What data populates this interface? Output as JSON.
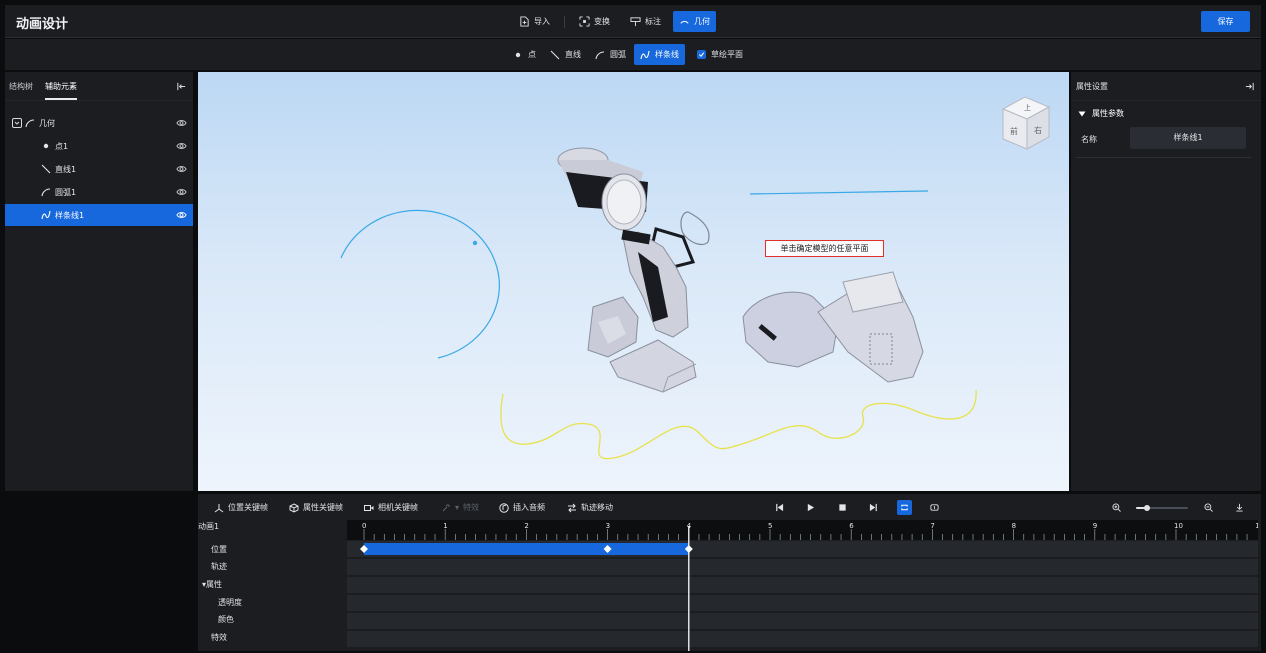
{
  "app": {
    "title": "动画设计"
  },
  "toolbar": {
    "import_label": "导入",
    "transform_label": "变换",
    "annotate_label": "标注",
    "geometry_label": "几何",
    "save_label": "保存"
  },
  "geometry_tools": {
    "point_label": "点",
    "line_label": "直线",
    "arc_label": "圆弧",
    "spline_label": "样条线",
    "sketch_plane_label": "草绘平面"
  },
  "left_panel": {
    "tabs": [
      "结构树",
      "辅助元素"
    ],
    "tree": [
      {
        "label": "几何",
        "icon": "arc-icon",
        "type": "group"
      },
      {
        "label": "点1",
        "icon": "point-icon"
      },
      {
        "label": "直线1",
        "icon": "line-icon"
      },
      {
        "label": "圆弧1",
        "icon": "arc-icon"
      },
      {
        "label": "样条线1",
        "icon": "spline-icon",
        "selected": true
      }
    ]
  },
  "viewport": {
    "hint": "单击确定模型的任意平面",
    "view_cube": {
      "top": "上",
      "front": "前",
      "right": "右"
    }
  },
  "right_panel": {
    "title": "属性设置",
    "section_label": "属性参数",
    "name_label": "名称",
    "name_value": "样条线1"
  },
  "timeline": {
    "buttons": {
      "position_keyframe": "位置关键帧",
      "property_keyframe": "属性关键帧",
      "camera_keyframe": "相机关键帧",
      "effects": "特效",
      "insert_audio": "插入音频",
      "track_move": "轨迹移动"
    },
    "animation_name": "动画1",
    "rows": [
      "位置",
      "轨迹",
      "▾属性",
      "透明度",
      "颜色",
      "特效"
    ],
    "ruler_ticks": [
      "0",
      "1",
      "2",
      "3",
      "4",
      "5",
      "6",
      "7",
      "8",
      "9",
      "10",
      "1"
    ],
    "position_keyframes": [
      0,
      3,
      4
    ],
    "position_bar": [
      0,
      4
    ],
    "playhead": 4
  },
  "colors": {
    "accent": "#1668dc",
    "panel": "#1b1d21",
    "sketch_blue": "#3aa8e6",
    "sketch_yellow": "#e8e24a"
  }
}
